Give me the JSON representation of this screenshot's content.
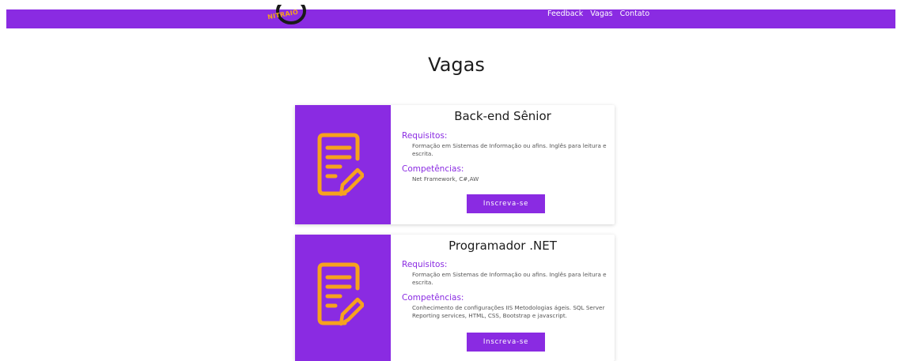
{
  "header": {
    "logo_text": "NITRAIO",
    "nav": [
      "Feedback",
      "Vagas",
      "Contato"
    ]
  },
  "page_title": "Vagas",
  "jobs": [
    {
      "title": "Back-end Sênior",
      "requirements_label": "Requisitos:",
      "requirements": "Formação em Sistemas de Informação ou afins. Inglês para leitura e escrita.",
      "skills_label": "Competências:",
      "skills": "Net Framework, C#,AW",
      "button": "Inscreva-se",
      "icon": "document-edit-icon"
    },
    {
      "title": "Programador .NET",
      "requirements_label": "Requisitos:",
      "requirements": "Formação em Sistemas de Informação ou afins. Inglês para leitura e escrita.",
      "skills_label": "Competências:",
      "skills": "Conhecimento de configurações IIS Metodologias ágeis. SQL Server Reporting services, HTML, CSS, Bootstrap e javascript.",
      "button": "Inscreva-se",
      "icon": "document-edit-icon"
    }
  ],
  "colors": {
    "accent": "#8a2be2",
    "icon": "#f6a21e"
  }
}
